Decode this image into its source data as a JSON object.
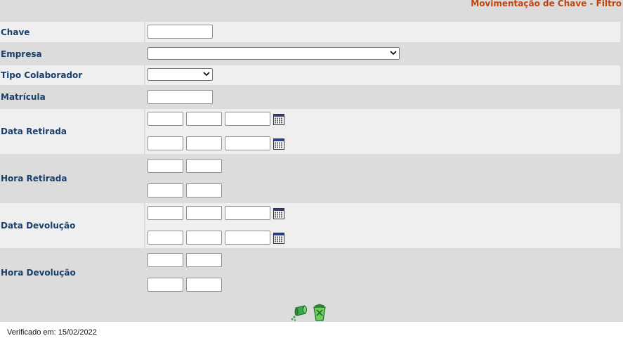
{
  "header": {
    "title": "Movimentação de Chave - Filtro"
  },
  "fields": {
    "chave": {
      "label": "Chave",
      "value": ""
    },
    "empresa": {
      "label": "Empresa",
      "selected": ""
    },
    "tipo_colaborador": {
      "label": "Tipo Colaborador",
      "selected": ""
    },
    "matricula": {
      "label": "Matrícula",
      "value": ""
    },
    "data_retirada": {
      "label": "Data Retirada"
    },
    "hora_retirada": {
      "label": "Hora Retirada"
    },
    "data_devolucao": {
      "label": "Data Devolução"
    },
    "hora_devolucao": {
      "label": "Hora Devolução"
    }
  },
  "icons": {
    "calendar": "calendar-icon",
    "search": "search-icon",
    "clear": "trash-icon"
  },
  "colors": {
    "title": "#c1440e",
    "label": "#1a3f6b",
    "row_light": "#efefef",
    "row_dark": "#dcdcdc"
  },
  "footer": {
    "text": "Verificado em: 15/02/2022"
  }
}
